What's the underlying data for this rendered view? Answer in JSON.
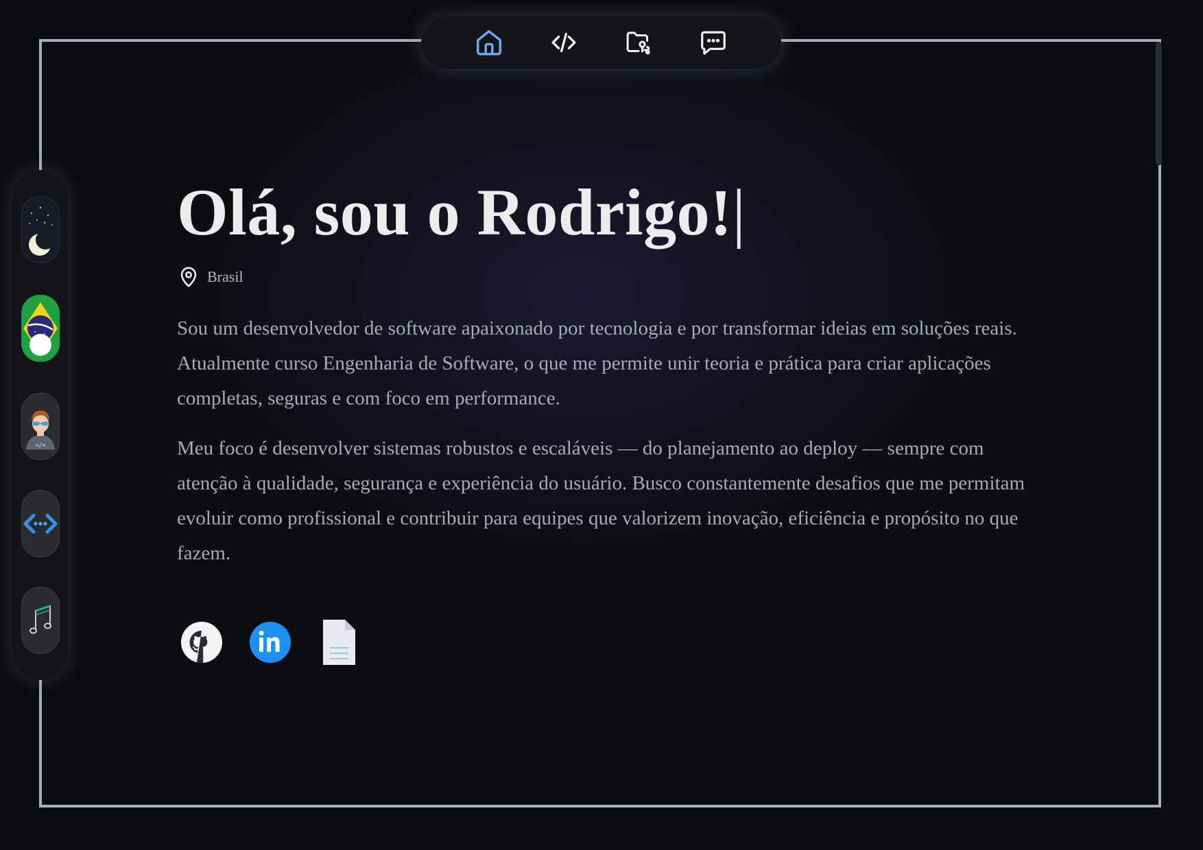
{
  "nav": {
    "items": [
      {
        "name": "home",
        "icon": "home-icon",
        "active": true
      },
      {
        "name": "code",
        "icon": "code-icon",
        "active": false
      },
      {
        "name": "projects",
        "icon": "folder-icon",
        "active": false
      },
      {
        "name": "contact",
        "icon": "chat-icon",
        "active": false
      }
    ],
    "active_color": "#6aa9f5",
    "icon_color": "#f2f2f2"
  },
  "sidebar": {
    "items": [
      {
        "name": "theme-toggle",
        "icon": "moon-icon",
        "mode": "dark"
      },
      {
        "name": "language-toggle",
        "icon": "brazil-flag-icon",
        "language": "pt-BR"
      },
      {
        "name": "avatar",
        "icon": "developer-avatar-icon"
      },
      {
        "name": "dev-mode",
        "icon": "code-brackets-icon"
      },
      {
        "name": "music",
        "icon": "music-note-icon"
      }
    ]
  },
  "hero": {
    "title": "Olá, sou o Rodrigo!",
    "cursor": "|",
    "location": "Brasil",
    "paragraph1": "Sou um desenvolvedor de software apaixonado por tecnologia e por transformar ideias em soluções reais. Atualmente curso Engenharia de Software, o que me permite unir teoria e prática para criar aplicações completas, seguras e com foco em performance.",
    "paragraph2": "Meu foco é desenvolver sistemas robustos e escaláveis — do planejamento ao deploy — sempre com atenção à qualidade, segurança e experiência do usuário. Busco constantemente desafios que me permitam evoluir como profissional e contribuir para equipes que valorizem inovação, eficiência e propósito no que fazem."
  },
  "socials": [
    {
      "name": "github",
      "icon": "github-icon"
    },
    {
      "name": "linkedin",
      "icon": "linkedin-icon",
      "text": "in"
    },
    {
      "name": "resume",
      "icon": "document-icon"
    }
  ],
  "colors": {
    "background": "#0b0c0f",
    "frame": "#a6aebb",
    "title": "#ececec",
    "text": "#a8abb3",
    "linkedin": "#1d8ff2"
  }
}
